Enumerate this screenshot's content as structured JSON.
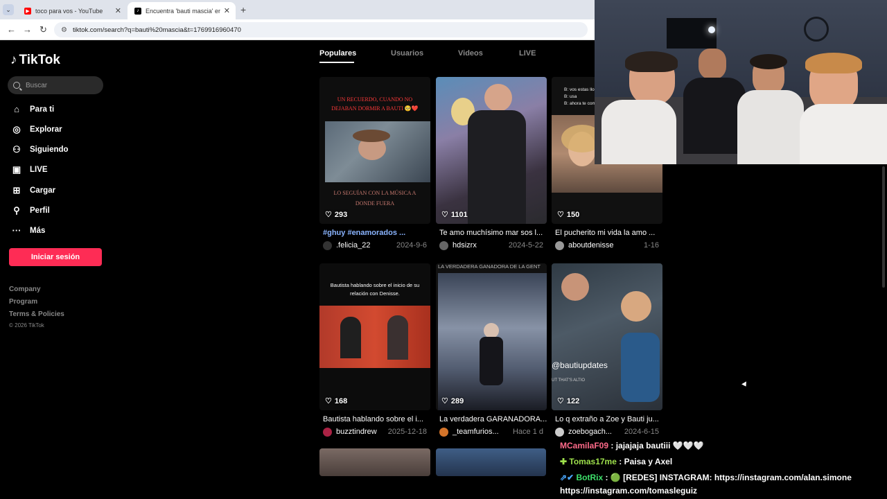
{
  "browser": {
    "tabs": [
      {
        "title": "toco para vos - YouTube",
        "favicon": "youtube-icon"
      },
      {
        "title": "Encuentra 'bauti mascia' en Tik",
        "favicon": "tiktok-icon"
      }
    ],
    "url": "tiktok.com/search?q=bauti%20mascia&t=1769916960470"
  },
  "sidebar": {
    "logo": "TikTok",
    "search_placeholder": "Buscar",
    "nav": [
      {
        "label": "Para ti",
        "icon": "home-icon"
      },
      {
        "label": "Explorar",
        "icon": "compass-icon"
      },
      {
        "label": "Siguiendo",
        "icon": "following-icon"
      },
      {
        "label": "LIVE",
        "icon": "live-icon"
      },
      {
        "label": "Cargar",
        "icon": "upload-icon"
      },
      {
        "label": "Perfil",
        "icon": "profile-icon"
      },
      {
        "label": "Más",
        "icon": "more-icon"
      }
    ],
    "login_label": "Iniciar sesión",
    "footer": [
      "Company",
      "Program",
      "Terms & Policies"
    ],
    "copyright": "© 2026 TikTok"
  },
  "search_tabs": [
    "Populares",
    "Usuarios",
    "Videos",
    "LIVE"
  ],
  "videos": [
    {
      "likes": "293",
      "desc": "#ghuy #enamorados ...",
      "user": ".felicia_22",
      "date": "2024-9-6",
      "overlay_top": "UN RECUERDO, CUANDO NO DEJABAN DORMIR A BAUTI 🥺❤️",
      "overlay_bottom": "LO SEGUÍAN CON LA MÚSICA A DONDE FUERA"
    },
    {
      "likes": "1101",
      "desc": "Te amo muchísimo mar sos l...",
      "user": "hdsizrx",
      "date": "2024-5-22"
    },
    {
      "likes": "150",
      "desc": "El pucherito mi vida la amo ...",
      "user": "aboutdenisse",
      "date": "1-16",
      "overlay_top": "B: vos estas llorand\nB: usa\nB: ahora te com"
    },
    {
      "likes": "168",
      "desc": "Bautista hablando sobre el i...",
      "user": "buzztindrew",
      "date": "2025-12-18",
      "overlay_top": "Bautista hablando sobre el inicio de su relación con Denisse."
    },
    {
      "likes": "289",
      "desc": "La verdadera GARANADORA...",
      "user": "_teamfurios...",
      "date": "Hace 1 d",
      "overlay_top": "LA VERDADERA GANADORA DE LA GENT"
    },
    {
      "likes": "122",
      "desc": "Lo q extraño a Zoe y Bauti ju...",
      "user": "zoebogach...",
      "date": "2024-6-15",
      "overlay_top": "@bautiupdates",
      "overlay_bottom": "UT THAT'S ALTIO"
    }
  ],
  "chat": [
    {
      "user": "MCamilaF09",
      "user_color": "#ff6b8a",
      "message": ": jajajaja bautiii 🤍🤍🤍"
    },
    {
      "user": "Tomas17me",
      "user_color": "#9ee04c",
      "message": ": Paisa y Axel"
    },
    {
      "user": "BotRix",
      "user_color": "#3ee06b",
      "message": ": 🟢 [REDES] INSTAGRAM: https://instagram.com/alan.simone"
    },
    {
      "user": "",
      "user_color": "#ffffff",
      "message": "https://instagram.com/tomasleguiz"
    }
  ],
  "colors": {
    "accent": "#fe2c55",
    "tag": "#8ab4ff"
  }
}
